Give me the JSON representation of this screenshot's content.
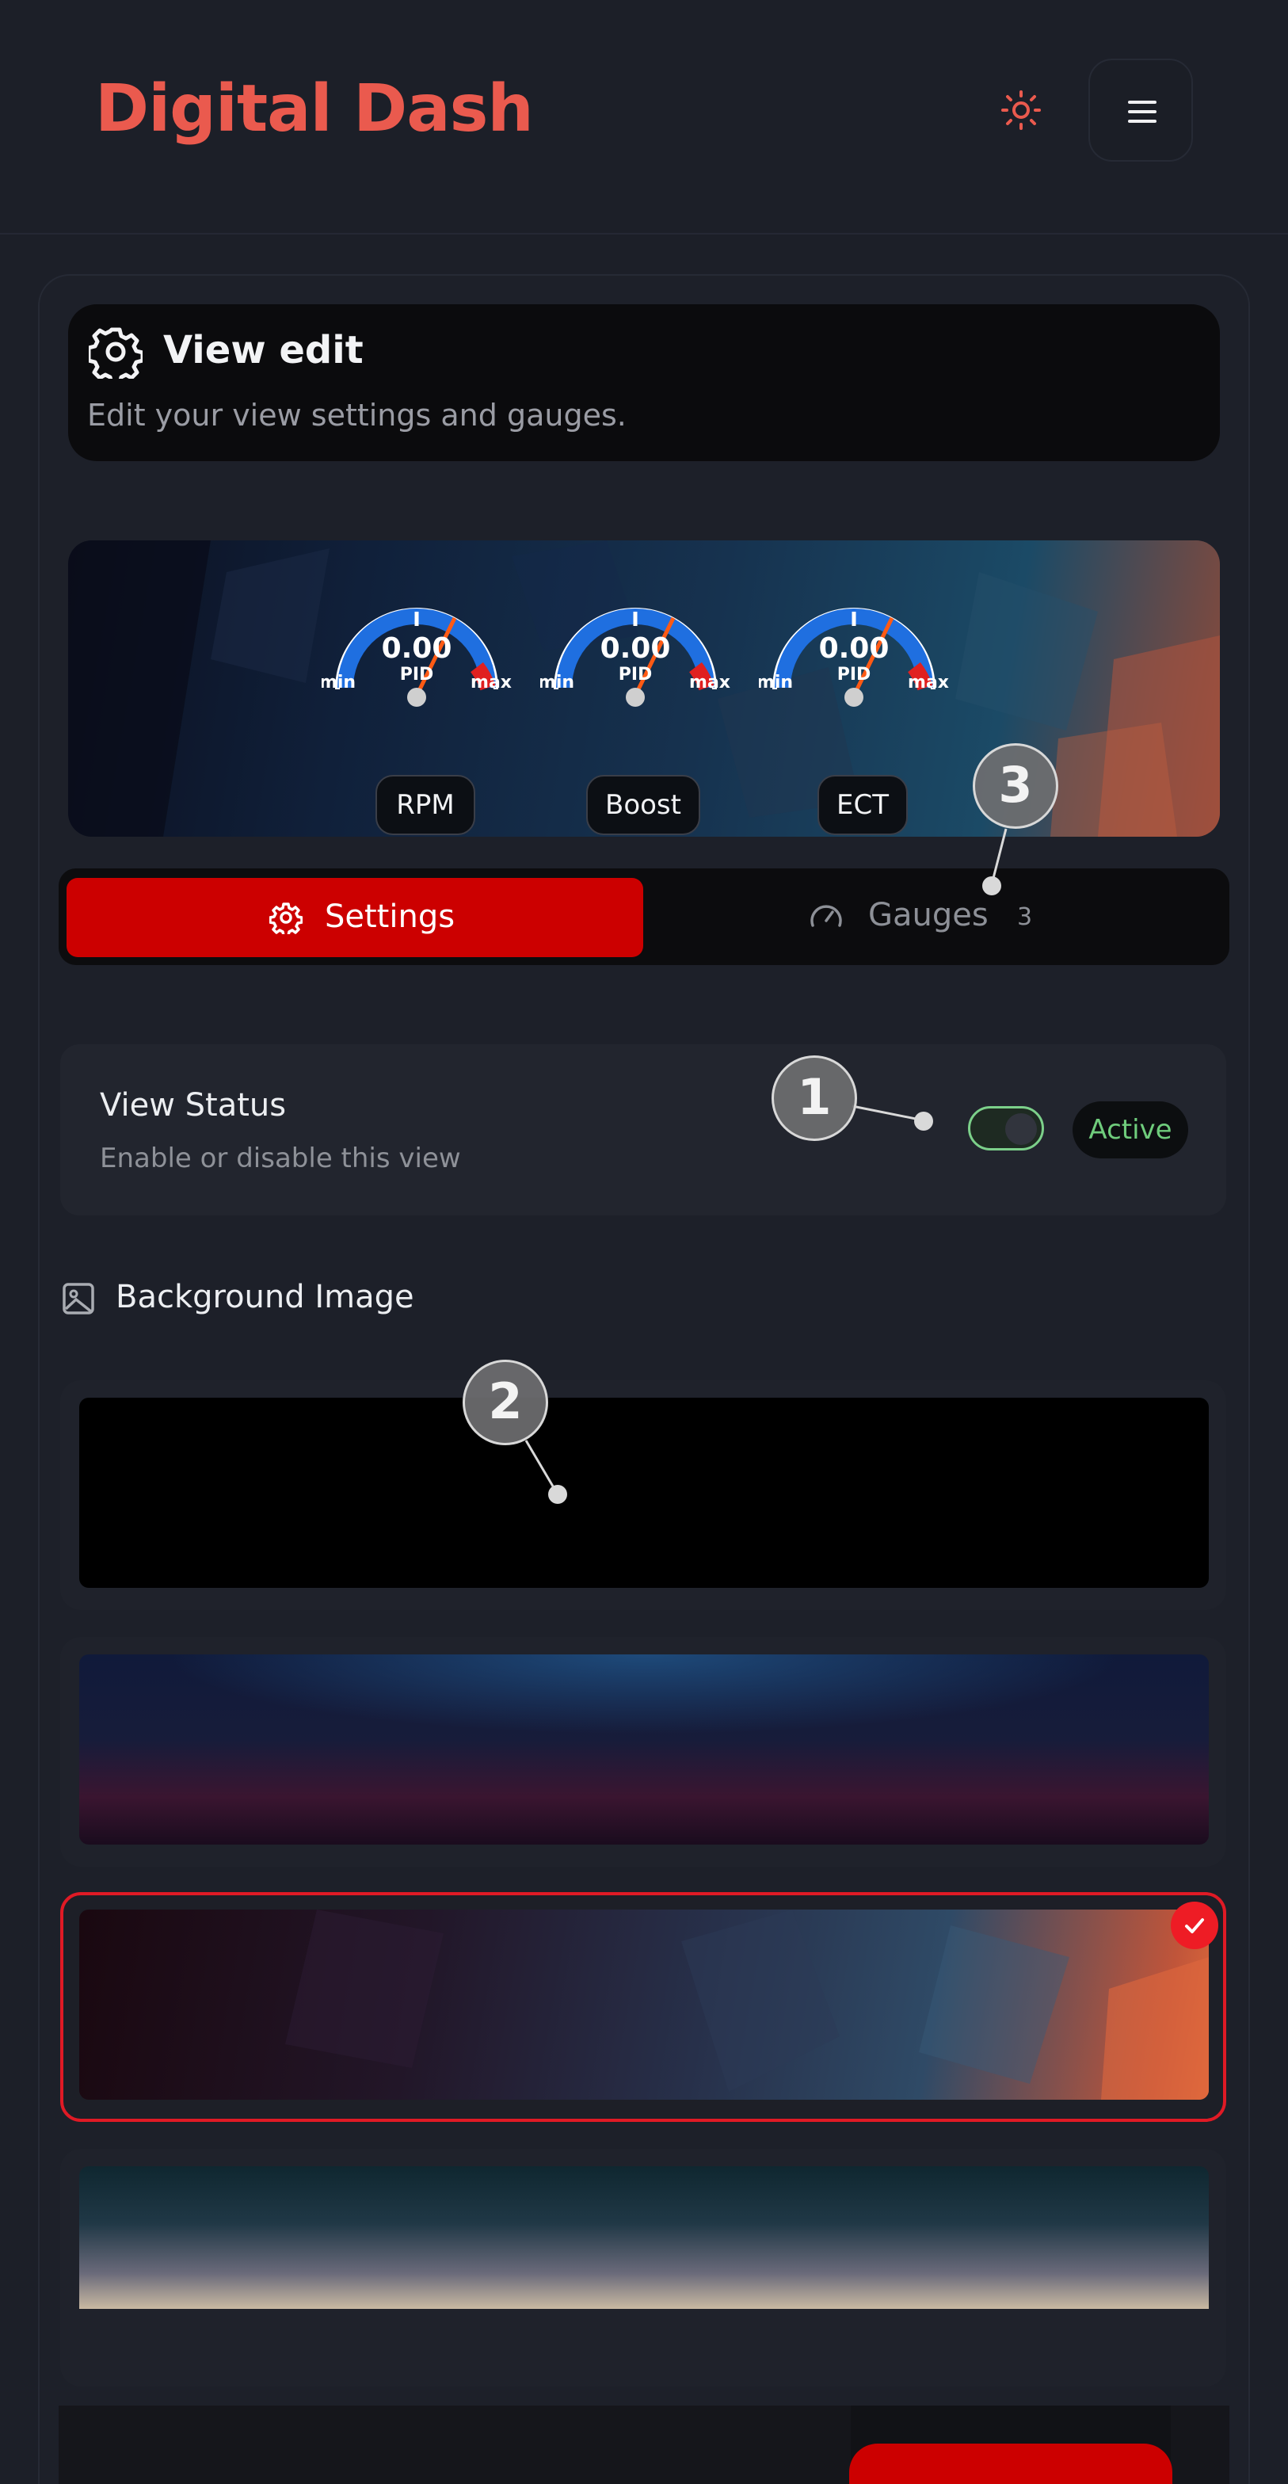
{
  "header": {
    "brand": "Digital Dash"
  },
  "view_edit": {
    "title": "View edit",
    "subtitle": "Edit your view settings and gauges."
  },
  "preview": {
    "gauges": [
      {
        "value": "0.00",
        "pid": "PID",
        "min": "min",
        "max": "max",
        "label": "RPM"
      },
      {
        "value": "0.00",
        "pid": "PID",
        "min": "min",
        "max": "max",
        "label": "Boost"
      },
      {
        "value": "0.00",
        "pid": "PID",
        "min": "min",
        "max": "max",
        "label": "ECT"
      }
    ]
  },
  "tabs": {
    "settings_label": "Settings",
    "gauges_label": "Gauges",
    "gauges_count": "3"
  },
  "view_status": {
    "title": "View Status",
    "subtitle": "Enable or disable this view",
    "badge": "Active",
    "enabled": true
  },
  "background": {
    "title": "Background Image",
    "selected_index": 2
  },
  "annotations": {
    "m1": "1",
    "m2": "2",
    "m3": "3"
  },
  "colors": {
    "accent": "#cc0000",
    "brand": "#ea5a4e",
    "success": "#6fcc7c"
  }
}
